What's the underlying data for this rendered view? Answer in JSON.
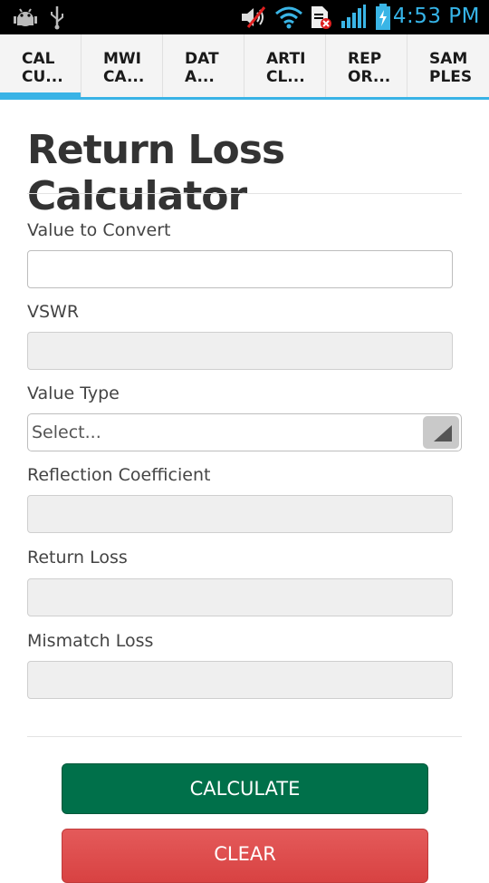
{
  "status_bar": {
    "time": "4:53 PM",
    "icons": [
      "android-debug-icon",
      "usb-icon",
      "mute-icon",
      "wifi-icon",
      "sim-error-icon",
      "signal-icon",
      "battery-charging-icon"
    ]
  },
  "tabs": [
    {
      "line1": "CAL",
      "line2": "CU...",
      "active": true
    },
    {
      "line1": "MWI",
      "line2": "CA...",
      "active": false
    },
    {
      "line1": "DAT",
      "line2": "A...",
      "active": false
    },
    {
      "line1": "ARTI",
      "line2": "CL...",
      "active": false
    },
    {
      "line1": "REP",
      "line2": "OR...",
      "active": false
    },
    {
      "line1": "SAM",
      "line2": "PLES",
      "active": false
    }
  ],
  "page": {
    "title": "Return Loss Calculator"
  },
  "form": {
    "value_to_convert": {
      "label": "Value to Convert",
      "value": ""
    },
    "vswr": {
      "label": "VSWR",
      "value": ""
    },
    "value_type": {
      "label": "Value Type",
      "selected": "Select..."
    },
    "reflection_coefficient": {
      "label": "Reflection Coefficient",
      "value": ""
    },
    "return_loss": {
      "label": "Return Loss",
      "value": ""
    },
    "mismatch_loss": {
      "label": "Mismatch Loss",
      "value": ""
    }
  },
  "buttons": {
    "calculate": "CALCULATE",
    "clear": "CLEAR"
  },
  "colors": {
    "accent": "#39b3e6",
    "calculate_bg": "#00704a",
    "clear_bg": "#d84242"
  }
}
